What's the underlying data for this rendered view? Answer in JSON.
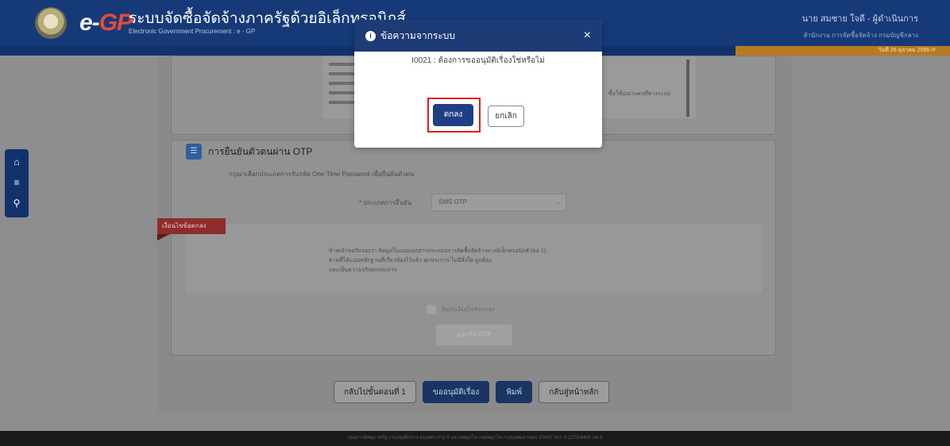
{
  "header": {
    "logo_e": "e-",
    "logo_gp": "GP",
    "title": "ระบบจัดซื้อจัดจ้างภาครัฐด้วยอิเล็กทรอนิกส์",
    "subtitle": "Electronic Government Procurement : e - GP",
    "user_name": "นาย สมชาย ใจดี - ผู้ดำเนินการ",
    "user_org": "สำนักงาน การจัดซื้อจัดจ้าง กรมบัญชีกลาง"
  },
  "subbar": {
    "date": "วันที่ 26 ตุลาคม 2566"
  },
  "sidenav": {
    "home_icon": "home-icon",
    "menu_icon": "menu-icon",
    "search_icon": "search-icon"
  },
  "document": {
    "side_text": "ซื้อใช้ปณาแผนที่ทางระบบ"
  },
  "otp": {
    "section_title": "การยืนยันตัวตนผ่าน OTP",
    "description": "กรุณาเลือกประเภทการรับรหัส One-Time Password เพื่อยืนยันตัวตน",
    "verify_label": "* ประเภทการยืนยัน",
    "verify_value": "SMS OTP",
    "ribbon": "เงื่อนไขข้อตกลง",
    "agree_lines": [
      "ข้าพเจ้าขอรับรองว่า ข้อมูลในแบบเอกสารประกอบการจัดซื้อจัดจ้างทางอิเล็กทรอนิกส์ (ตอ 1)",
      "ตามที่ได้แนบหลักฐานที่เกี่ยวข้องไว้แล้ว ทุกประการ ไม่มีสิ่งใด ถูกต้อง",
      "และเป็นความจริงทุกประการ"
    ],
    "agree_checkbox_label": "ยืนยันเงื่อนไขข้อตกลง",
    "request_otp_label": "ขอรหัส OTP"
  },
  "buttons": {
    "back": "กลับไปขั้นตอนที่ 1",
    "submit": "ขออนุมัติเรื่อง",
    "print": "พิมพ์",
    "home": "กลับสู่หน้าหลัก"
  },
  "footer": "กองการพัสดุภาครัฐ กรมบัญชีกลาง ถนนพระราม 6 แขวงพญาไท เขตพญาไท กรุงเทพมหานคร 10400 โทร. 0-2270-6400 กด 3",
  "modal": {
    "title": "ข้อความจากระบบ",
    "close_symbol": "×",
    "message": "I0021 : ต้องการขออนุมัติเรื่องใช่หรือไม่",
    "ok_label": "ตกลง",
    "cancel_label": "ยกเลิก",
    "highlight_color": "#e01b1b"
  }
}
